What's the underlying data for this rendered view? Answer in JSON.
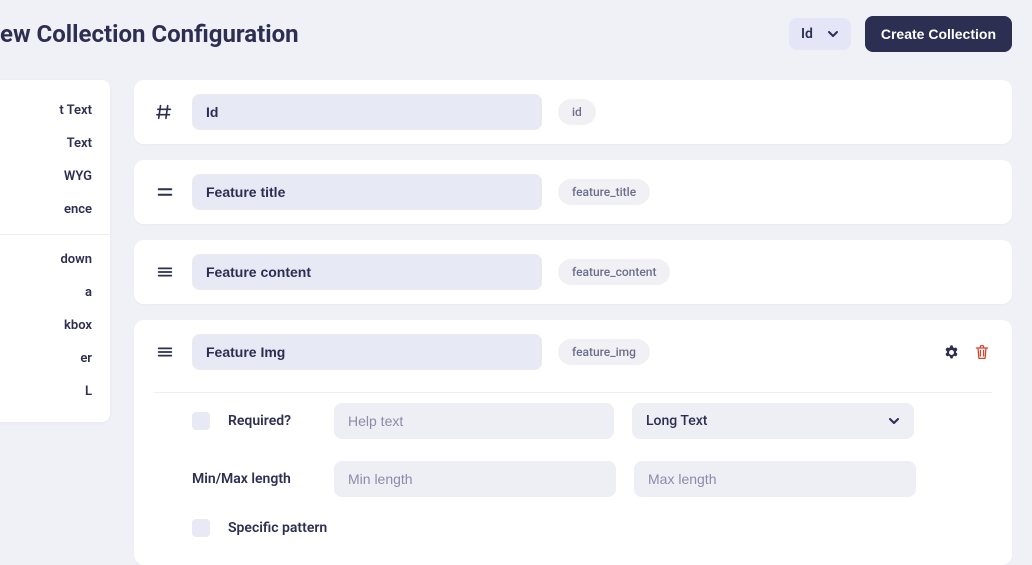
{
  "header": {
    "title": "ew Collection Configuration",
    "id_selector_label": "Id",
    "create_button_label": "Create Collection"
  },
  "sidebar": {
    "items_a": [
      {
        "label": "t Text"
      },
      {
        "label": "Text"
      },
      {
        "label": "WYG"
      },
      {
        "label": "ence"
      }
    ],
    "items_b": [
      {
        "label": "down"
      },
      {
        "label": "a"
      },
      {
        "label": "kbox"
      },
      {
        "label": "er"
      },
      {
        "label": "L"
      }
    ]
  },
  "fields": [
    {
      "name": "Id",
      "slug": "id",
      "icon": "hash"
    },
    {
      "name": "Feature title",
      "slug": "feature_title",
      "icon": "drag"
    },
    {
      "name": "Feature content",
      "slug": "feature_content",
      "icon": "drag"
    },
    {
      "name": "Feature Img",
      "slug": "feature_img",
      "icon": "drag",
      "expanded": {
        "required_label": "Required?",
        "help_placeholder": "Help text",
        "type_selected": "Long Text",
        "minmax_label": "Min/Max length",
        "min_placeholder": "Min length",
        "max_placeholder": "Max length",
        "pattern_label": "Specific pattern"
      }
    }
  ]
}
